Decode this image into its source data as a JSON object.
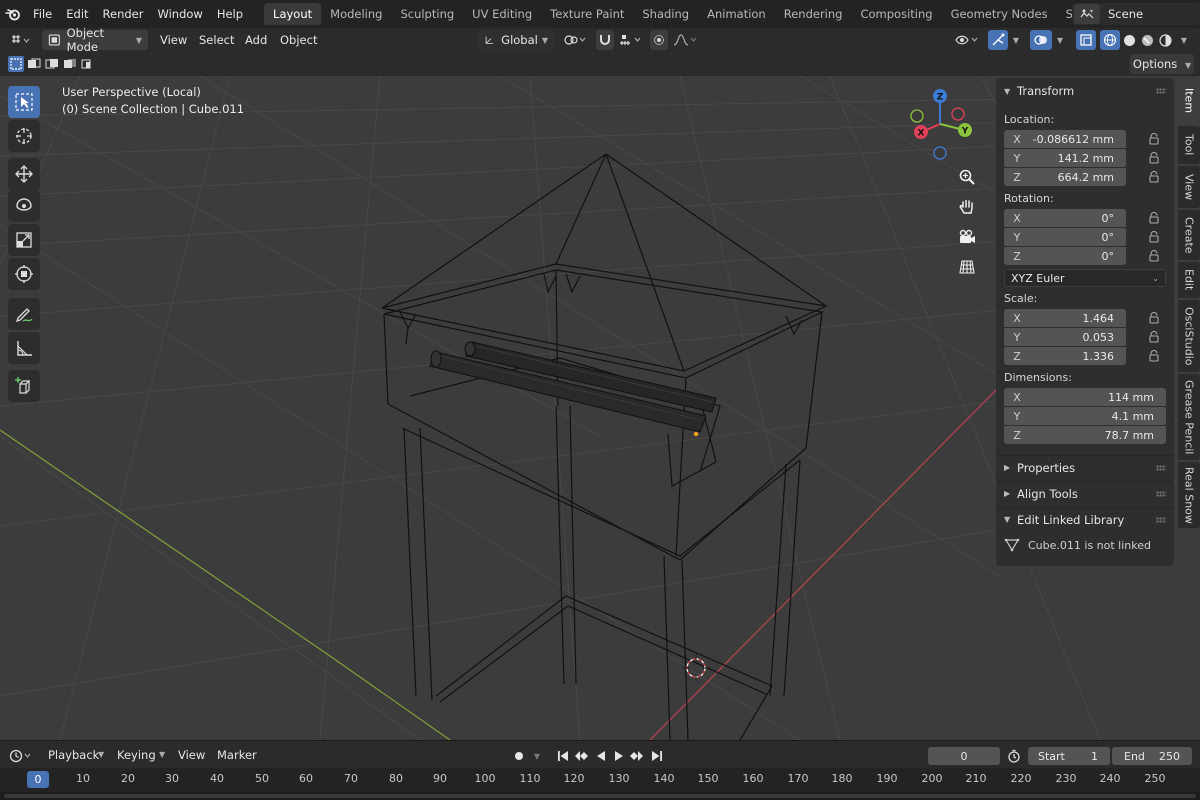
{
  "menubar": {
    "items": [
      "File",
      "Edit",
      "Render",
      "Window",
      "Help"
    ],
    "workspaces": [
      "Layout",
      "Modeling",
      "Sculpting",
      "UV Editing",
      "Texture Paint",
      "Shading",
      "Animation",
      "Rendering",
      "Compositing",
      "Geometry Nodes",
      "Scripting"
    ],
    "active_workspace": "Layout",
    "add_workspace": "+",
    "scene": "Scene"
  },
  "header": {
    "mode": "Object Mode",
    "menus": [
      "View",
      "Select",
      "Add",
      "Object"
    ],
    "orientation": "Global"
  },
  "toolbar_row": {
    "options": "Options"
  },
  "viewport": {
    "perspective": "User Perspective (Local)",
    "collection": "(0) Scene Collection | Cube.011",
    "gizmo_axes": [
      "X",
      "Y",
      "Z"
    ],
    "axis_colors": {
      "x": "#e0405a",
      "y": "#8ac43c",
      "z": "#3c7ad8"
    },
    "tools": [
      "select-box",
      "cursor",
      "move",
      "rotate",
      "scale",
      "transform",
      "annotate",
      "measure",
      "add-cube"
    ],
    "active_tool": "select-box",
    "nav_buttons": [
      "zoom",
      "pan",
      "camera",
      "grid"
    ]
  },
  "npanel": {
    "transform_title": "Transform",
    "location_label": "Location:",
    "location": [
      {
        "axis": "X",
        "value": "-0.086612 mm"
      },
      {
        "axis": "Y",
        "value": "141.2 mm"
      },
      {
        "axis": "Z",
        "value": "664.2 mm"
      }
    ],
    "rotation_label": "Rotation:",
    "rotation": [
      {
        "axis": "X",
        "value": "0°"
      },
      {
        "axis": "Y",
        "value": "0°"
      },
      {
        "axis": "Z",
        "value": "0°"
      }
    ],
    "rotation_mode": "XYZ Euler",
    "scale_label": "Scale:",
    "scale": [
      {
        "axis": "X",
        "value": "1.464"
      },
      {
        "axis": "Y",
        "value": "0.053"
      },
      {
        "axis": "Z",
        "value": "1.336"
      }
    ],
    "dimensions_label": "Dimensions:",
    "dimensions": [
      {
        "axis": "X",
        "value": "114 mm"
      },
      {
        "axis": "Y",
        "value": "4.1 mm"
      },
      {
        "axis": "Z",
        "value": "78.7 mm"
      }
    ],
    "properties_title": "Properties",
    "align_tools_title": "Align Tools",
    "edit_linked_title": "Edit Linked Library",
    "linked_message": "Cube.011 is not linked",
    "tabs": [
      "Item",
      "Tool",
      "View",
      "Create",
      "Edit",
      "OsciStudio",
      "Grease Pencil",
      "Real Snow"
    ],
    "active_tab": "Item"
  },
  "timeline": {
    "menus": [
      "Playback",
      "Keying",
      "View",
      "Marker"
    ],
    "current_frame": "0",
    "start_label": "Start",
    "start": "1",
    "end_label": "End",
    "end": "250",
    "ruler_ticks": [
      "0",
      "10",
      "20",
      "30",
      "40",
      "50",
      "60",
      "70",
      "80",
      "90",
      "100",
      "110",
      "120",
      "130",
      "140",
      "150",
      "160",
      "170",
      "180",
      "190",
      "200",
      "210",
      "220",
      "230",
      "240",
      "250"
    ],
    "ruler_current": "0"
  }
}
